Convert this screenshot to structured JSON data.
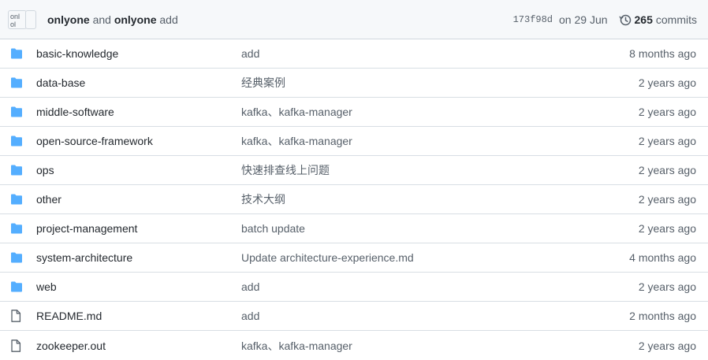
{
  "latest_commit": {
    "author_1": "onlyone",
    "joiner": "and",
    "author_2": "onlyone",
    "message": "add",
    "avatar_alt": "onl ol",
    "sha": "173f98d",
    "date": "on 29 Jun",
    "commit_count": "265",
    "commits_label": "commits"
  },
  "colors": {
    "folder": "#54aeff",
    "file": "#57606a",
    "border": "#d8dee4"
  },
  "files": [
    {
      "type": "dir",
      "icon": "folder-icon",
      "name": "basic-knowledge",
      "message": "add",
      "age": "8 months ago"
    },
    {
      "type": "dir",
      "icon": "folder-icon",
      "name": "data-base",
      "message": "经典案例",
      "age": "2 years ago"
    },
    {
      "type": "dir",
      "icon": "folder-icon",
      "name": "middle-software",
      "message": "kafka、kafka-manager",
      "age": "2 years ago"
    },
    {
      "type": "dir",
      "icon": "folder-icon",
      "name": "open-source-framework",
      "message": "kafka、kafka-manager",
      "age": "2 years ago"
    },
    {
      "type": "dir",
      "icon": "folder-icon",
      "name": "ops",
      "message": "快速排查线上问题",
      "age": "2 years ago"
    },
    {
      "type": "dir",
      "icon": "folder-icon",
      "name": "other",
      "message": "技术大纲",
      "age": "2 years ago"
    },
    {
      "type": "dir",
      "icon": "folder-icon",
      "name": "project-management",
      "message": "batch update",
      "age": "2 years ago"
    },
    {
      "type": "dir",
      "icon": "folder-icon",
      "name": "system-architecture",
      "message": "Update architecture-experience.md",
      "age": "4 months ago"
    },
    {
      "type": "dir",
      "icon": "folder-icon",
      "name": "web",
      "message": "add",
      "age": "2 years ago"
    },
    {
      "type": "file",
      "icon": "file-icon",
      "name": "README.md",
      "message": "add",
      "age": "2 months ago"
    },
    {
      "type": "file",
      "icon": "file-icon",
      "name": "zookeeper.out",
      "message": "kafka、kafka-manager",
      "age": "2 years ago"
    }
  ]
}
